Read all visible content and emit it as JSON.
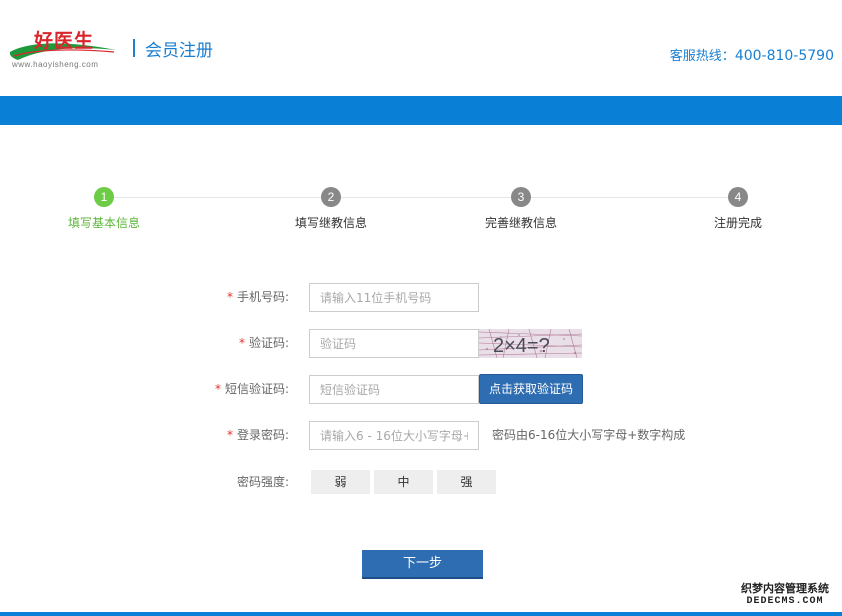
{
  "header": {
    "logo_text": "好医生",
    "logo_url": "www.haoyisheng.com",
    "title": "会员注册",
    "hotline_label": "客服热线：",
    "hotline_number": "400-810-5790"
  },
  "steps": [
    {
      "num": "1",
      "label": "填写基本信息",
      "active": true
    },
    {
      "num": "2",
      "label": "填写继教信息",
      "active": false
    },
    {
      "num": "3",
      "label": "完善继教信息",
      "active": false
    },
    {
      "num": "4",
      "label": "注册完成",
      "active": false
    }
  ],
  "form": {
    "required_mark": "*",
    "phone": {
      "label": "手机号码:",
      "placeholder": "请输入11位手机号码"
    },
    "captcha": {
      "label": "验证码:",
      "placeholder": "验证码",
      "image_text": "2×4=?"
    },
    "sms": {
      "label": "短信验证码:",
      "placeholder": "短信验证码",
      "button": "点击获取验证码"
    },
    "password": {
      "label": "登录密码:",
      "placeholder": "请输入6 - 16位大小写字母+",
      "hint": "密码由6-16位大小写字母+数字构成"
    },
    "strength": {
      "label": "密码强度:",
      "levels": [
        "弱",
        "中",
        "强"
      ]
    }
  },
  "next_button": "下一步",
  "watermark": {
    "line1": "织梦内容管理系统",
    "line2": "DEDECMS.COM"
  },
  "colors": {
    "brand_blue": "#0a7fd6",
    "button_blue": "#2e6db1",
    "step_active": "#6dcc45",
    "step_inactive": "#888888",
    "required_red": "#e5322d",
    "logo_red": "#d9262c",
    "logo_green": "#1e9a3a"
  }
}
